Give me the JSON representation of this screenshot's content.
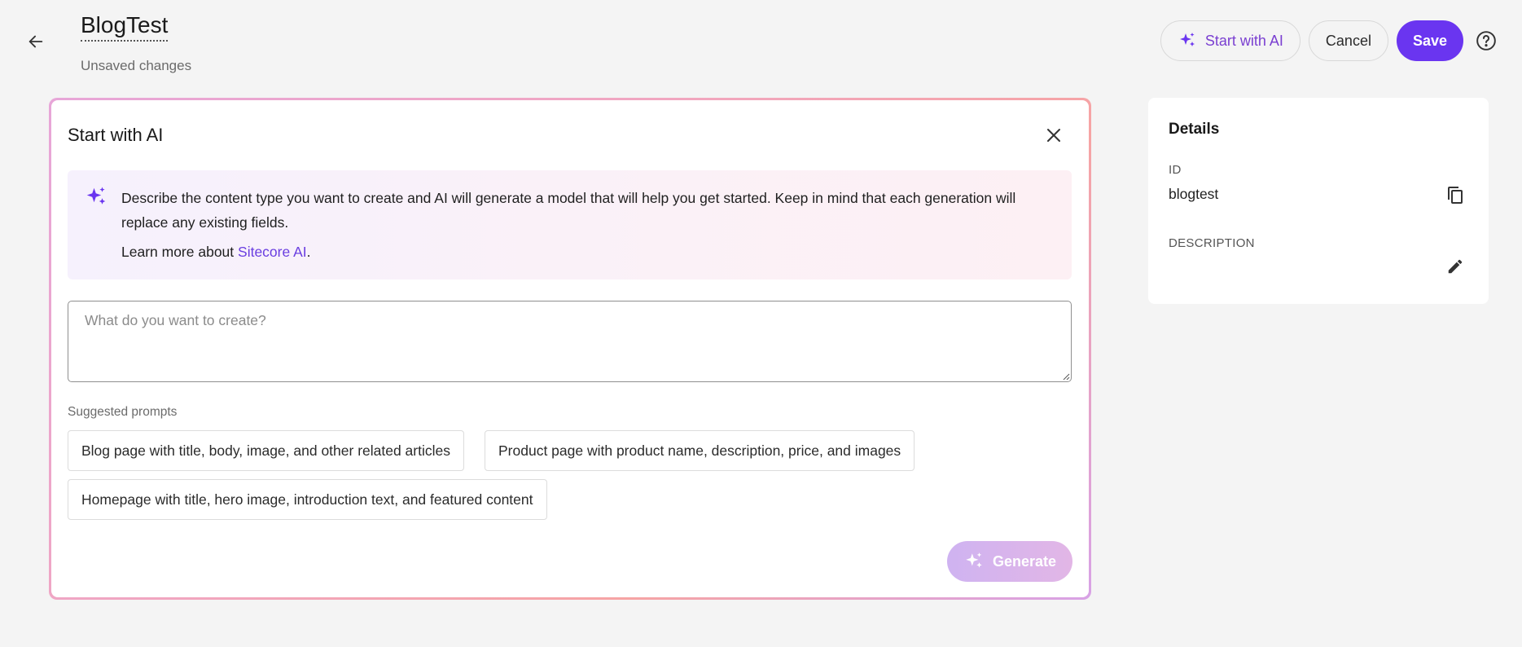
{
  "header": {
    "title": "BlogTest",
    "subtitle": "Unsaved changes",
    "start_ai_label": "Start with AI",
    "cancel_label": "Cancel",
    "save_label": "Save"
  },
  "ai_panel": {
    "title": "Start with AI",
    "info_text": "Describe the content type you want to create and AI will generate a model that will help you get started. Keep in mind that each generation will replace any existing fields.",
    "learn_prefix": "Learn more about ",
    "learn_link": "Sitecore AI",
    "learn_suffix": ".",
    "prompt_placeholder": "What do you want to create?",
    "prompt_value": "",
    "suggested_label": "Suggested prompts",
    "suggestions": [
      "Blog page with title, body, image, and other related articles",
      "Product page with product name, description, price, and images",
      "Homepage with title, hero image, introduction text, and featured content"
    ],
    "generate_label": "Generate"
  },
  "details": {
    "title": "Details",
    "id_label": "ID",
    "id_value": "blogtest",
    "description_label": "DESCRIPTION",
    "description_value": ""
  },
  "colors": {
    "accent": "#6a35f0",
    "ai_text": "#7a3fd1",
    "link": "#6a3ee0",
    "page_bg": "#f4f4f4"
  },
  "icons": [
    "arrow-left-icon",
    "sparkle-icon",
    "help-circle-icon",
    "close-icon",
    "copy-icon",
    "pencil-icon"
  ]
}
